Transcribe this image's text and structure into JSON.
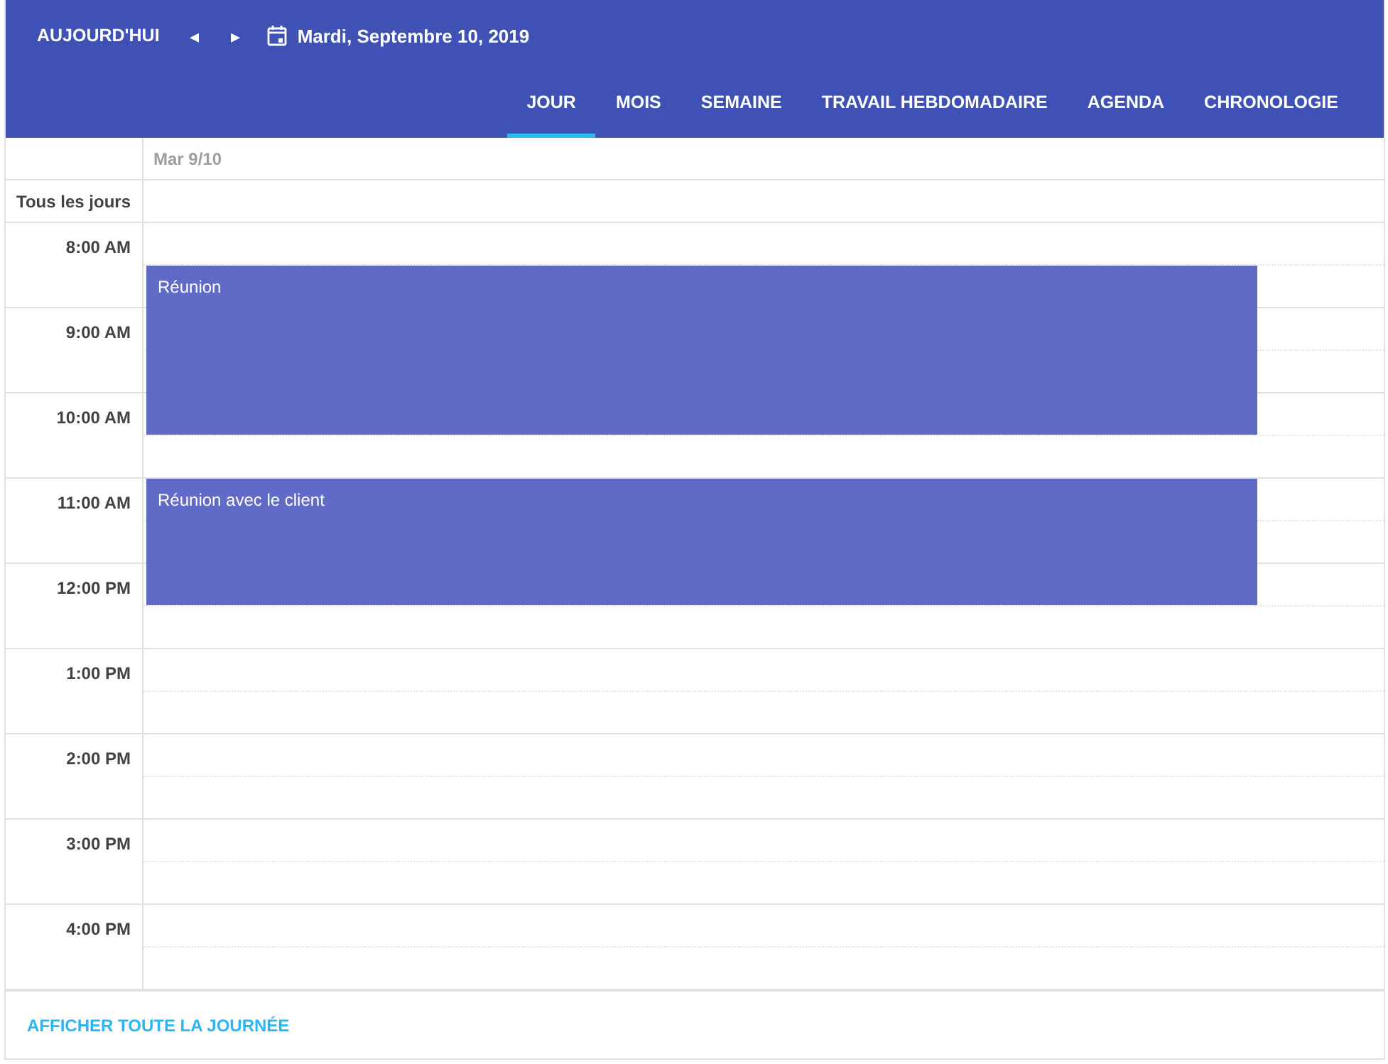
{
  "toolbar": {
    "today": "AUJOURD'HUI",
    "prev": "◂",
    "next": "▸",
    "date": "Mardi, Septembre 10, 2019"
  },
  "views": [
    {
      "label": "JOUR",
      "selected": true
    },
    {
      "label": "MOIS",
      "selected": false
    },
    {
      "label": "SEMAINE",
      "selected": false
    },
    {
      "label": "TRAVAIL HEBDOMADAIRE",
      "selected": false
    },
    {
      "label": "AGENDA",
      "selected": false
    },
    {
      "label": "CHRONOLOGIE",
      "selected": false
    }
  ],
  "day_header": "Mar 9/10",
  "all_day_label": "Tous les jours",
  "hours": [
    {
      "label": "8:00 AM",
      "halves": [
        {
          "booked": false
        },
        {
          "booked": true,
          "event": "Réunion"
        }
      ]
    },
    {
      "label": "9:00 AM",
      "halves": [
        {
          "booked": true
        },
        {
          "booked": true
        }
      ]
    },
    {
      "label": "10:00 AM",
      "halves": [
        {
          "booked": true
        },
        {
          "booked": false
        }
      ]
    },
    {
      "label": "11:00 AM",
      "halves": [
        {
          "booked": true,
          "event": "Réunion avec le client"
        },
        {
          "booked": true
        }
      ]
    },
    {
      "label": "12:00 PM",
      "halves": [
        {
          "booked": true
        },
        {
          "booked": false
        }
      ]
    },
    {
      "label": "1:00 PM",
      "halves": [
        {
          "booked": false
        },
        {
          "booked": false
        }
      ]
    },
    {
      "label": "2:00 PM",
      "halves": [
        {
          "booked": false
        },
        {
          "booked": false
        }
      ]
    },
    {
      "label": "3:00 PM",
      "halves": [
        {
          "booked": false
        },
        {
          "booked": false
        }
      ]
    },
    {
      "label": "4:00 PM",
      "halves": [
        {
          "booked": false
        },
        {
          "booked": false
        }
      ]
    }
  ],
  "footer_link": "AFFICHER TOUTE LA JOURNÉE"
}
